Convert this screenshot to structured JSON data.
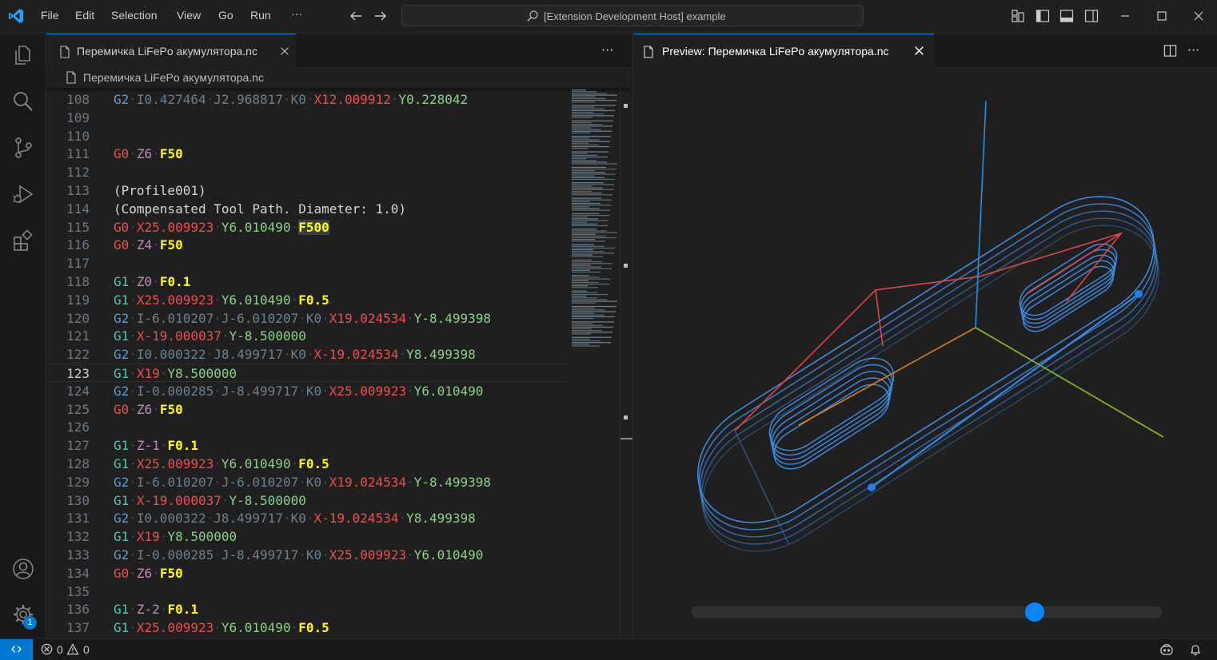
{
  "titlebar": {
    "menu": [
      "File",
      "Edit",
      "Selection",
      "View",
      "Go",
      "Run"
    ],
    "more": "···",
    "command_center": "[Extension Development Host] example"
  },
  "activitybar": {
    "accounts_badge": "1"
  },
  "editor": {
    "tab_label": "Перемичка LiFePo акумулятора.nc",
    "breadcrumb": "Перемичка LiFePo акумулятора.nc",
    "more": "···",
    "current_line": "123",
    "lines": [
      {
        "n": "108",
        "tokens": [
          [
            "G2",
            "g"
          ],
          [
            " ",
            "s"
          ],
          [
            "I0.427464",
            "dim"
          ],
          [
            " ",
            "s"
          ],
          [
            "J2.968817",
            "dim"
          ],
          [
            " ",
            "s"
          ],
          [
            "K0",
            "dim"
          ],
          [
            " ",
            "s"
          ],
          [
            "X12.009912",
            "r"
          ],
          [
            " ",
            "s"
          ],
          [
            "Y0.228042",
            "gn"
          ]
        ]
      },
      {
        "n": "109",
        "tokens": []
      },
      {
        "n": "110",
        "tokens": []
      },
      {
        "n": "111",
        "tokens": [
          [
            "G0",
            "r"
          ],
          [
            " ",
            "s"
          ],
          [
            "Z6",
            "z"
          ],
          [
            " ",
            "s"
          ],
          [
            "F50",
            "f"
          ]
        ]
      },
      {
        "n": "112",
        "tokens": []
      },
      {
        "n": "113",
        "tokens": [
          [
            "(Profile001)",
            "c"
          ]
        ]
      },
      {
        "n": "114",
        "tokens": [
          [
            "(Compensated Tool Path. Diameter: 1.0)",
            "c"
          ]
        ]
      },
      {
        "n": "115",
        "tokens": [
          [
            "G0",
            "r"
          ],
          [
            " ",
            "s"
          ],
          [
            "X25.009923",
            "r"
          ],
          [
            " ",
            "s"
          ],
          [
            "Y6.010490",
            "gn"
          ],
          [
            " ",
            "s"
          ],
          [
            "F500",
            "fh"
          ]
        ]
      },
      {
        "n": "116",
        "tokens": [
          [
            "G0",
            "r"
          ],
          [
            " ",
            "s"
          ],
          [
            "Z4",
            "z"
          ],
          [
            " ",
            "s"
          ],
          [
            "F50",
            "f"
          ]
        ]
      },
      {
        "n": "117",
        "tokens": []
      },
      {
        "n": "118",
        "tokens": [
          [
            "G1",
            "gr"
          ],
          [
            " ",
            "s"
          ],
          [
            "Z0",
            "z"
          ],
          [
            " ",
            "s"
          ],
          [
            "F0.1",
            "f"
          ]
        ]
      },
      {
        "n": "119",
        "tokens": [
          [
            "G1",
            "gr"
          ],
          [
            " ",
            "s"
          ],
          [
            "X25.009923",
            "r"
          ],
          [
            " ",
            "s"
          ],
          [
            "Y6.010490",
            "gn"
          ],
          [
            " ",
            "s"
          ],
          [
            "F0.5",
            "f"
          ]
        ]
      },
      {
        "n": "120",
        "tokens": [
          [
            "G2",
            "g"
          ],
          [
            " ",
            "s"
          ],
          [
            "I-6.010207",
            "dim"
          ],
          [
            " ",
            "s"
          ],
          [
            "J-6.010207",
            "dim"
          ],
          [
            " ",
            "s"
          ],
          [
            "K0",
            "dim"
          ],
          [
            " ",
            "s"
          ],
          [
            "X19.024534",
            "r"
          ],
          [
            " ",
            "s"
          ],
          [
            "Y-8.499398",
            "gn"
          ]
        ]
      },
      {
        "n": "121",
        "tokens": [
          [
            "G1",
            "gr"
          ],
          [
            " ",
            "s"
          ],
          [
            "X-19.000037",
            "r"
          ],
          [
            " ",
            "s"
          ],
          [
            "Y-8.500000",
            "gn"
          ]
        ]
      },
      {
        "n": "122",
        "tokens": [
          [
            "G2",
            "g"
          ],
          [
            " ",
            "s"
          ],
          [
            "I0.000322",
            "dim"
          ],
          [
            " ",
            "s"
          ],
          [
            "J8.499717",
            "dim"
          ],
          [
            " ",
            "s"
          ],
          [
            "K0",
            "dim"
          ],
          [
            " ",
            "s"
          ],
          [
            "X-19.024534",
            "r"
          ],
          [
            " ",
            "s"
          ],
          [
            "Y8.499398",
            "gn"
          ]
        ]
      },
      {
        "n": "123",
        "tokens": [
          [
            "G1",
            "gr"
          ],
          [
            " ",
            "s"
          ],
          [
            "X19",
            "r"
          ],
          [
            " ",
            "s"
          ],
          [
            "Y8.500000",
            "gn"
          ]
        ]
      },
      {
        "n": "124",
        "tokens": [
          [
            "G2",
            "g"
          ],
          [
            " ",
            "s"
          ],
          [
            "I-0.000285",
            "dim"
          ],
          [
            " ",
            "s"
          ],
          [
            "J-8.499717",
            "dim"
          ],
          [
            " ",
            "s"
          ],
          [
            "K0",
            "dim"
          ],
          [
            " ",
            "s"
          ],
          [
            "X25.009923",
            "r"
          ],
          [
            " ",
            "s"
          ],
          [
            "Y6.010490",
            "gn"
          ]
        ]
      },
      {
        "n": "125",
        "tokens": [
          [
            "G0",
            "r"
          ],
          [
            " ",
            "s"
          ],
          [
            "Z6",
            "z"
          ],
          [
            " ",
            "s"
          ],
          [
            "F50",
            "f"
          ]
        ]
      },
      {
        "n": "126",
        "tokens": []
      },
      {
        "n": "127",
        "tokens": [
          [
            "G1",
            "gr"
          ],
          [
            " ",
            "s"
          ],
          [
            "Z-1",
            "z"
          ],
          [
            " ",
            "s"
          ],
          [
            "F0.1",
            "f"
          ]
        ]
      },
      {
        "n": "128",
        "tokens": [
          [
            "G1",
            "gr"
          ],
          [
            " ",
            "s"
          ],
          [
            "X25.009923",
            "r"
          ],
          [
            " ",
            "s"
          ],
          [
            "Y6.010490",
            "gn"
          ],
          [
            " ",
            "s"
          ],
          [
            "F0.5",
            "f"
          ]
        ]
      },
      {
        "n": "129",
        "tokens": [
          [
            "G2",
            "g"
          ],
          [
            " ",
            "s"
          ],
          [
            "I-6.010207",
            "dim"
          ],
          [
            " ",
            "s"
          ],
          [
            "J-6.010207",
            "dim"
          ],
          [
            " ",
            "s"
          ],
          [
            "K0",
            "dim"
          ],
          [
            " ",
            "s"
          ],
          [
            "X19.024534",
            "r"
          ],
          [
            " ",
            "s"
          ],
          [
            "Y-8.499398",
            "gn"
          ]
        ]
      },
      {
        "n": "130",
        "tokens": [
          [
            "G1",
            "gr"
          ],
          [
            " ",
            "s"
          ],
          [
            "X-19.000037",
            "r"
          ],
          [
            " ",
            "s"
          ],
          [
            "Y-8.500000",
            "gn"
          ]
        ]
      },
      {
        "n": "131",
        "tokens": [
          [
            "G2",
            "g"
          ],
          [
            " ",
            "s"
          ],
          [
            "I0.000322",
            "dim"
          ],
          [
            " ",
            "s"
          ],
          [
            "J8.499717",
            "dim"
          ],
          [
            " ",
            "s"
          ],
          [
            "K0",
            "dim"
          ],
          [
            " ",
            "s"
          ],
          [
            "X-19.024534",
            "r"
          ],
          [
            " ",
            "s"
          ],
          [
            "Y8.499398",
            "gn"
          ]
        ]
      },
      {
        "n": "132",
        "tokens": [
          [
            "G1",
            "gr"
          ],
          [
            " ",
            "s"
          ],
          [
            "X19",
            "r"
          ],
          [
            " ",
            "s"
          ],
          [
            "Y8.500000",
            "gn"
          ]
        ]
      },
      {
        "n": "133",
        "tokens": [
          [
            "G2",
            "g"
          ],
          [
            " ",
            "s"
          ],
          [
            "I-0.000285",
            "dim"
          ],
          [
            " ",
            "s"
          ],
          [
            "J-8.499717",
            "dim"
          ],
          [
            " ",
            "s"
          ],
          [
            "K0",
            "dim"
          ],
          [
            " ",
            "s"
          ],
          [
            "X25.009923",
            "r"
          ],
          [
            " ",
            "s"
          ],
          [
            "Y6.010490",
            "gn"
          ]
        ]
      },
      {
        "n": "134",
        "tokens": [
          [
            "G0",
            "r"
          ],
          [
            " ",
            "s"
          ],
          [
            "Z6",
            "z"
          ],
          [
            " ",
            "s"
          ],
          [
            "F50",
            "f"
          ]
        ]
      },
      {
        "n": "135",
        "tokens": []
      },
      {
        "n": "136",
        "tokens": [
          [
            "G1",
            "gr"
          ],
          [
            " ",
            "s"
          ],
          [
            "Z-2",
            "z"
          ],
          [
            " ",
            "s"
          ],
          [
            "F0.1",
            "f"
          ]
        ]
      },
      {
        "n": "137",
        "tokens": [
          [
            "G1",
            "gr"
          ],
          [
            " ",
            "s"
          ],
          [
            "X25.009923",
            "r"
          ],
          [
            " ",
            "s"
          ],
          [
            "Y6.010490",
            "gn"
          ],
          [
            " ",
            "s"
          ],
          [
            "F0.5",
            "f"
          ]
        ]
      }
    ]
  },
  "preview": {
    "tab_label": "Preview: Перемичка LiFePo акумулятора.nc",
    "more": "···",
    "slider_value": 0.73
  },
  "statusbar": {
    "errors": "0",
    "warnings": "0"
  },
  "colors": {
    "accent": "#0078d4",
    "toolpath": "#3b8fe8",
    "rapid": "#e04040",
    "axis_x": "#e07020",
    "axis_y": "#90c020",
    "axis_z": "#2090e0"
  }
}
